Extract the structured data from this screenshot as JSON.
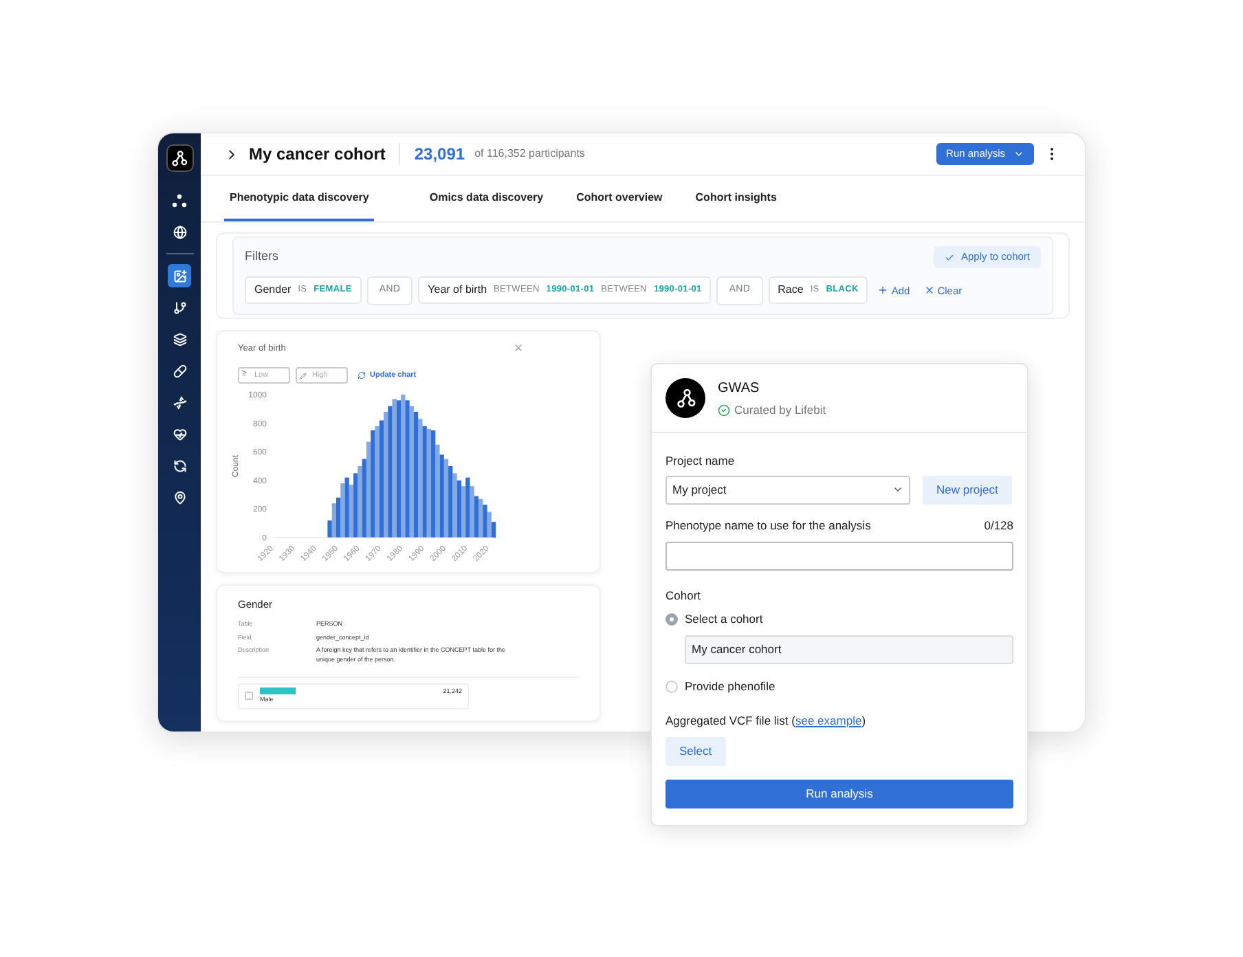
{
  "sidebar": {
    "items": [
      {
        "selected": false
      },
      {
        "selected": false
      },
      {
        "selected": true
      },
      {
        "selected": false
      },
      {
        "selected": false
      },
      {
        "selected": false
      },
      {
        "selected": false
      },
      {
        "selected": false
      },
      {
        "selected": false
      },
      {
        "selected": false
      }
    ]
  },
  "header": {
    "title": "My cancer cohort",
    "count": "23,091",
    "count_suffix": "of 116,352 participants",
    "run_button": "Run analysis"
  },
  "tabs": [
    {
      "label": "Phenotypic data discovery",
      "selected": true
    },
    {
      "label": "Omics data discovery",
      "selected": false
    },
    {
      "label": "Cohort overview",
      "selected": false
    },
    {
      "label": "Cohort insights",
      "selected": false
    }
  ],
  "filters": {
    "title": "Filters",
    "apply_button": "Apply to cohort",
    "chips": [
      {
        "kind": "condition",
        "parts": [
          {
            "kind": "field",
            "text": "Gender"
          },
          {
            "kind": "operator",
            "text": "IS"
          },
          {
            "kind": "value",
            "text": "FEMALE"
          }
        ]
      },
      {
        "kind": "connector",
        "text": "AND"
      },
      {
        "kind": "condition",
        "parts": [
          {
            "kind": "field",
            "text": "Year of birth"
          },
          {
            "kind": "operator",
            "text": "BETWEEN"
          },
          {
            "kind": "value",
            "text": "1990-01-01"
          },
          {
            "kind": "operator",
            "text": "BETWEEN"
          },
          {
            "kind": "value",
            "text": "1990-01-01"
          }
        ]
      },
      {
        "kind": "connector",
        "text": "AND"
      },
      {
        "kind": "condition",
        "parts": [
          {
            "kind": "field",
            "text": "Race"
          },
          {
            "kind": "operator",
            "text": "IS"
          },
          {
            "kind": "value",
            "text": "BLACK"
          }
        ]
      }
    ],
    "add_link": "Add",
    "clear_link": "Clear"
  },
  "year_card": {
    "title": "Year of birth",
    "low": {
      "symbol": "≥",
      "placeholder": "Low"
    },
    "high": {
      "placeholder": "High"
    },
    "update_link": "Update chart",
    "chart_data": {
      "type": "bar",
      "ylabel": "Count",
      "x": [
        1946,
        1948,
        1950,
        1952,
        1954,
        1956,
        1958,
        1960,
        1962,
        1964,
        1966,
        1968,
        1970,
        1972,
        1974,
        1976,
        1978,
        1980,
        1982,
        1984,
        1986,
        1988,
        1990,
        1992,
        1994,
        1996,
        1998,
        2000,
        2002,
        2004,
        2006,
        2008,
        2010,
        2012,
        2014,
        2016,
        2018,
        2020,
        2022
      ],
      "series": [
        {
          "color": "#2f6fd6",
          "values": [
            120,
            240,
            280,
            380,
            420,
            370,
            450,
            500,
            550,
            670,
            750,
            780,
            820,
            880,
            920,
            970,
            960,
            1000,
            960,
            920,
            880,
            830,
            780,
            760,
            750,
            650,
            580,
            550,
            500,
            450,
            400,
            360,
            420,
            360,
            290,
            270,
            230,
            180,
            110
          ]
        }
      ],
      "xlim": [
        1920,
        2022
      ],
      "ylim": [
        0,
        1000
      ],
      "xticks": [
        1920,
        1930,
        1940,
        1950,
        1960,
        1970,
        1980,
        1990,
        2000,
        2010,
        2020
      ],
      "yticks": [
        0,
        200,
        400,
        600,
        800,
        1000
      ]
    }
  },
  "gender_card": {
    "title": "Gender",
    "details": [
      {
        "label": "Table",
        "value": "PERSON"
      },
      {
        "label": "Field",
        "value": "gender_concept_id"
      },
      {
        "label": "Description",
        "value": "A foreign key that refers to an identifier in the CONCEPT table for the unique gender of the person."
      }
    ],
    "rows": [
      {
        "label": "Male",
        "count": "21,242",
        "checked": false,
        "level": 0.2
      }
    ]
  },
  "gwas": {
    "title": "GWAS",
    "curated": "Curated by Lifebit",
    "project_label": "Project name",
    "project_value": "My project",
    "new_project": "New project",
    "phenotype_label": "Phenotype name to use for the analysis",
    "phenotype_counter": "0/128",
    "cohort_label": "Cohort",
    "cohort_options": [
      {
        "label": "Select a cohort",
        "selected": true,
        "field_value": "My cancer cohort"
      },
      {
        "label": "Provide phenofile",
        "selected": false
      }
    ],
    "vcf_before": "Aggregated VCF file list (",
    "vcf_link": "see example",
    "vcf_after": ")",
    "select_button": "Select",
    "run_button": "Run analysis"
  }
}
